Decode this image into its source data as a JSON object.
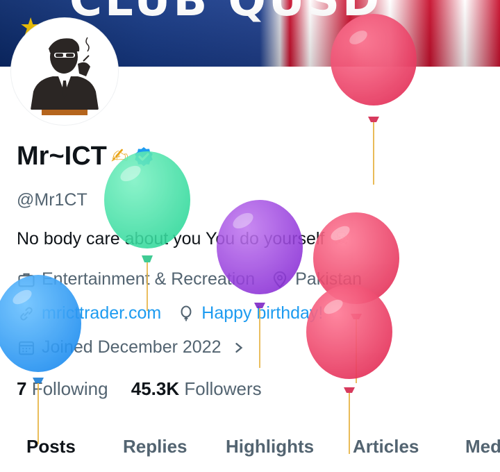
{
  "banner": {
    "text": "CLUB QUSD"
  },
  "profile": {
    "display_name": "Mr~ICT",
    "name_emoji": "✍",
    "handle": "@Mr1CT",
    "bio": "No body care about you You do yourself",
    "bio_emoji": "☠"
  },
  "meta": {
    "category": "Entertainment & Recreation",
    "location": "Pakistan",
    "website": "mricttrader.com",
    "birthday": "Happy birthday!",
    "joined": "Joined December 2022"
  },
  "stats": {
    "following_count": "7",
    "following_label": "Following",
    "followers_count": "45.3K",
    "followers_label": "Followers"
  },
  "tabs": [
    {
      "label": "Posts",
      "active": true
    },
    {
      "label": "Replies"
    },
    {
      "label": "Highlights"
    },
    {
      "label": "Articles"
    },
    {
      "label": "Media"
    }
  ],
  "colors": {
    "accent": "#1d9bf0",
    "text": "#0f1419",
    "secondary": "#536471"
  },
  "icons": [
    "verified-badge-icon",
    "briefcase-icon",
    "location-icon",
    "link-icon",
    "balloon-icon",
    "calendar-icon",
    "chevron-right-icon"
  ]
}
